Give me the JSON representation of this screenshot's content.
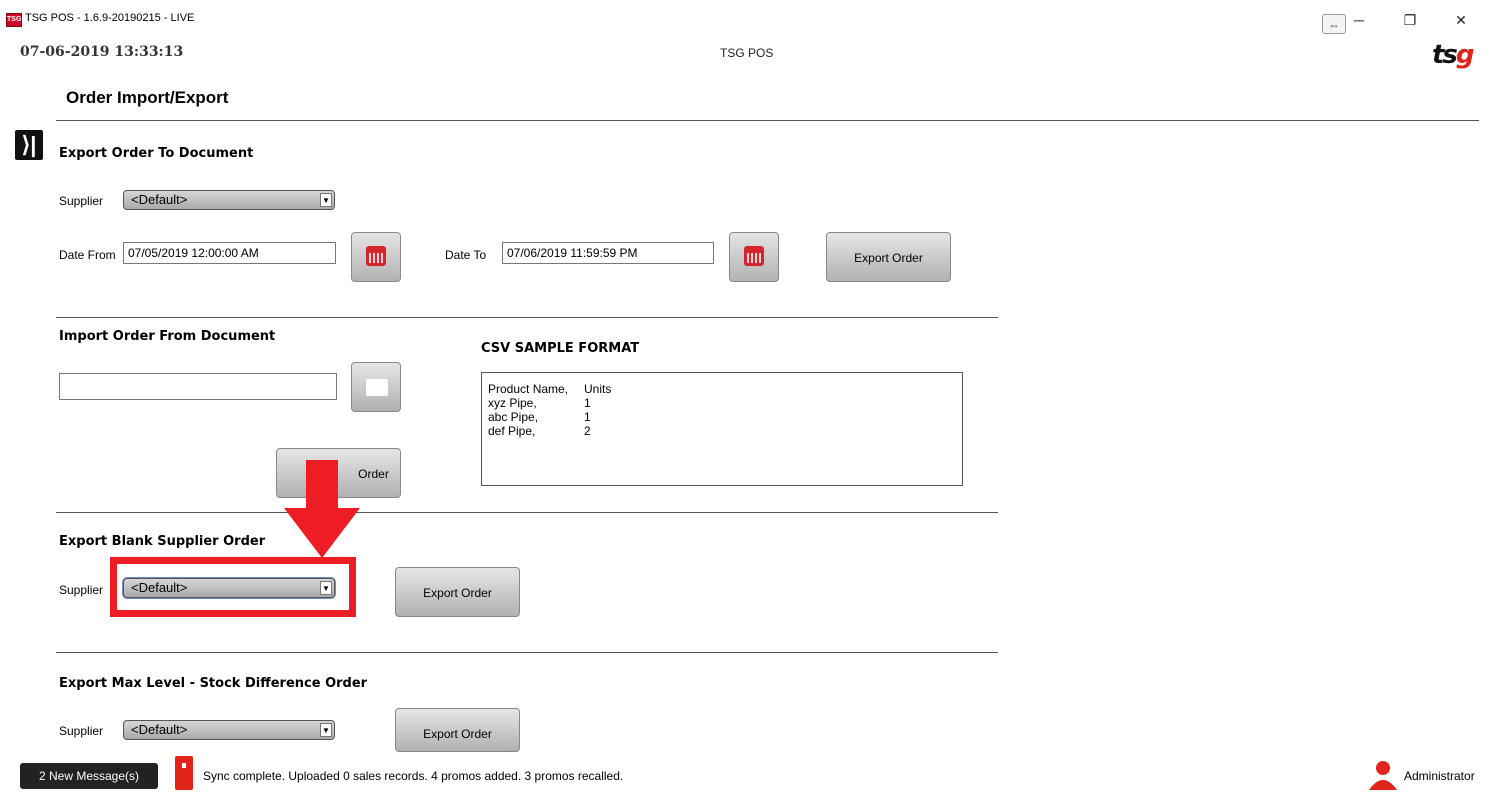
{
  "window": {
    "app_icon_text": "TSG",
    "title": "TSG POS - 1.6.9-20190215 - LIVE",
    "swap_glyph": "⇔",
    "minimize_glyph": "─",
    "restore_glyph": "❐",
    "close_glyph": "✕"
  },
  "header": {
    "datetime": "07-06-2019 13:33:13",
    "center_title": "TSG POS",
    "logo_ts": "ts",
    "logo_g": "g"
  },
  "page": {
    "title": "Order Import/Export",
    "collapse_glyph": "⟩|"
  },
  "export_to_document": {
    "heading": "Export Order To Document",
    "supplier_label": "Supplier",
    "supplier_value": "<Default>",
    "date_from_label": "Date From",
    "date_from_value": "07/05/2019 12:00:00 AM",
    "date_to_label": "Date To",
    "date_to_value": "07/06/2019 11:59:59 PM",
    "export_button": "Export Order"
  },
  "import_from_document": {
    "heading": "Import Order From Document",
    "file_path": "",
    "import_button_visible": "Order"
  },
  "csv_sample": {
    "heading": "CSV SAMPLE FORMAT",
    "rows": [
      [
        "Product Name,",
        "Units"
      ],
      [
        "xyz Pipe,",
        "1"
      ],
      [
        "abc Pipe,",
        "1"
      ],
      [
        "def Pipe,",
        "2"
      ]
    ]
  },
  "export_blank_supplier": {
    "heading": "Export Blank Supplier Order",
    "supplier_label": "Supplier",
    "supplier_value": "<Default>",
    "export_button": "Export Order"
  },
  "export_max_level": {
    "heading": "Export Max Level - Stock Difference Order",
    "supplier_label": "Supplier",
    "supplier_value": "<Default>",
    "export_button": "Export Order"
  },
  "status_bar": {
    "messages_button": "2 New Message(s)",
    "sync_text": "Sync complete.  Uploaded 0 sales records. 4 promos added. 3 promos recalled.",
    "user": "Administrator"
  },
  "colors": {
    "accent_red": "#e2231a",
    "highlight_red": "#ee1c24"
  },
  "icons": [
    "app-icon",
    "swap-icon",
    "calendar-icon",
    "folder-icon",
    "dropdown-arrow-icon",
    "sync-server-icon",
    "user-icon",
    "collapse-panel-icon"
  ]
}
